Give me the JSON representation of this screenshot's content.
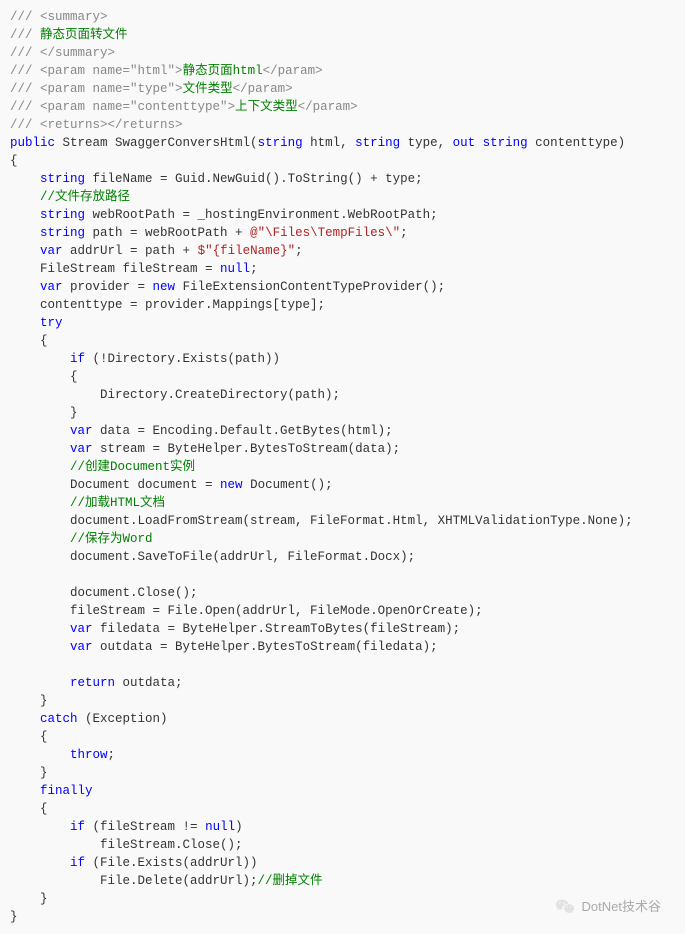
{
  "lines": [
    {
      "indent": 0,
      "spans": [
        {
          "t": "/// <summary>",
          "c": "comment"
        }
      ]
    },
    {
      "indent": 0,
      "spans": [
        {
          "t": "/// ",
          "c": "comment"
        },
        {
          "t": "静态页面转文件",
          "c": "green"
        }
      ]
    },
    {
      "indent": 0,
      "spans": [
        {
          "t": "/// </summary>",
          "c": "comment"
        }
      ]
    },
    {
      "indent": 0,
      "spans": [
        {
          "t": "/// <param name=",
          "c": "comment"
        },
        {
          "t": "\"html\"",
          "c": "comment"
        },
        {
          "t": ">",
          "c": "comment"
        },
        {
          "t": "静态页面html",
          "c": "green"
        },
        {
          "t": "</param>",
          "c": "comment"
        }
      ]
    },
    {
      "indent": 0,
      "spans": [
        {
          "t": "/// <param name=",
          "c": "comment"
        },
        {
          "t": "\"type\"",
          "c": "comment"
        },
        {
          "t": ">",
          "c": "comment"
        },
        {
          "t": "文件类型",
          "c": "green"
        },
        {
          "t": "</param>",
          "c": "comment"
        }
      ]
    },
    {
      "indent": 0,
      "spans": [
        {
          "t": "/// <param name=",
          "c": "comment"
        },
        {
          "t": "\"contenttype\"",
          "c": "comment"
        },
        {
          "t": ">",
          "c": "comment"
        },
        {
          "t": "上下文类型",
          "c": "green"
        },
        {
          "t": "</param>",
          "c": "comment"
        }
      ]
    },
    {
      "indent": 0,
      "spans": [
        {
          "t": "/// <returns></returns>",
          "c": "comment"
        }
      ]
    },
    {
      "indent": 0,
      "spans": [
        {
          "t": "public",
          "c": "keyword"
        },
        {
          "t": " Stream SwaggerConversHtml(",
          "c": "plain"
        },
        {
          "t": "string",
          "c": "keyword"
        },
        {
          "t": " html, ",
          "c": "plain"
        },
        {
          "t": "string",
          "c": "keyword"
        },
        {
          "t": " type, ",
          "c": "plain"
        },
        {
          "t": "out",
          "c": "keyword"
        },
        {
          "t": " ",
          "c": "plain"
        },
        {
          "t": "string",
          "c": "keyword"
        },
        {
          "t": " contenttype)",
          "c": "plain"
        }
      ]
    },
    {
      "indent": 0,
      "spans": [
        {
          "t": "{",
          "c": "plain"
        }
      ]
    },
    {
      "indent": 1,
      "spans": [
        {
          "t": "string",
          "c": "keyword"
        },
        {
          "t": " fileName = Guid.NewGuid().ToString() + type;",
          "c": "plain"
        }
      ]
    },
    {
      "indent": 1,
      "spans": [
        {
          "t": "//文件存放路径",
          "c": "green"
        }
      ]
    },
    {
      "indent": 1,
      "spans": [
        {
          "t": "string",
          "c": "keyword"
        },
        {
          "t": " webRootPath = _hostingEnvironment.WebRootPath;",
          "c": "plain"
        }
      ]
    },
    {
      "indent": 1,
      "spans": [
        {
          "t": "string",
          "c": "keyword"
        },
        {
          "t": " path = webRootPath + ",
          "c": "plain"
        },
        {
          "t": "@\"\\Files\\TempFiles\\\"",
          "c": "string"
        },
        {
          "t": ";",
          "c": "plain"
        }
      ]
    },
    {
      "indent": 1,
      "spans": [
        {
          "t": "var",
          "c": "keyword"
        },
        {
          "t": " addrUrl = path + ",
          "c": "plain"
        },
        {
          "t": "$\"{fileName}\"",
          "c": "string"
        },
        {
          "t": ";",
          "c": "plain"
        }
      ]
    },
    {
      "indent": 1,
      "spans": [
        {
          "t": "FileStream fileStream = ",
          "c": "plain"
        },
        {
          "t": "null",
          "c": "keyword"
        },
        {
          "t": ";",
          "c": "plain"
        }
      ]
    },
    {
      "indent": 1,
      "spans": [
        {
          "t": "var",
          "c": "keyword"
        },
        {
          "t": " provider = ",
          "c": "plain"
        },
        {
          "t": "new",
          "c": "keyword"
        },
        {
          "t": " FileExtensionContentTypeProvider();",
          "c": "plain"
        }
      ]
    },
    {
      "indent": 1,
      "spans": [
        {
          "t": "contenttype = provider.Mappings[type];",
          "c": "plain"
        }
      ]
    },
    {
      "indent": 1,
      "spans": [
        {
          "t": "try",
          "c": "keyword"
        }
      ]
    },
    {
      "indent": 1,
      "spans": [
        {
          "t": "{",
          "c": "plain"
        }
      ]
    },
    {
      "indent": 2,
      "spans": [
        {
          "t": "if",
          "c": "keyword"
        },
        {
          "t": " (!Directory.Exists(path))",
          "c": "plain"
        }
      ]
    },
    {
      "indent": 2,
      "spans": [
        {
          "t": "{",
          "c": "plain"
        }
      ]
    },
    {
      "indent": 3,
      "spans": [
        {
          "t": "Directory.CreateDirectory(path);",
          "c": "plain"
        }
      ]
    },
    {
      "indent": 2,
      "spans": [
        {
          "t": "}",
          "c": "plain"
        }
      ]
    },
    {
      "indent": 2,
      "spans": [
        {
          "t": "var",
          "c": "keyword"
        },
        {
          "t": " data = Encoding.Default.GetBytes(html);",
          "c": "plain"
        }
      ]
    },
    {
      "indent": 2,
      "spans": [
        {
          "t": "var",
          "c": "keyword"
        },
        {
          "t": " stream = ByteHelper.BytesToStream(data);",
          "c": "plain"
        }
      ]
    },
    {
      "indent": 2,
      "spans": [
        {
          "t": "//创建Document实例",
          "c": "green"
        }
      ]
    },
    {
      "indent": 2,
      "spans": [
        {
          "t": "Document document = ",
          "c": "plain"
        },
        {
          "t": "new",
          "c": "keyword"
        },
        {
          "t": " Document();",
          "c": "plain"
        }
      ]
    },
    {
      "indent": 2,
      "spans": [
        {
          "t": "//加载HTML文档",
          "c": "green"
        }
      ]
    },
    {
      "indent": 2,
      "spans": [
        {
          "t": "document.LoadFromStream(stream, FileFormat.Html, XHTMLValidationType.None);",
          "c": "plain"
        }
      ]
    },
    {
      "indent": 2,
      "spans": [
        {
          "t": "//保存为Word",
          "c": "green"
        }
      ]
    },
    {
      "indent": 2,
      "spans": [
        {
          "t": "document.SaveToFile(addrUrl, FileFormat.Docx);",
          "c": "plain"
        }
      ]
    },
    {
      "indent": 0,
      "spans": [
        {
          "t": " ",
          "c": "plain"
        }
      ]
    },
    {
      "indent": 2,
      "spans": [
        {
          "t": "document.Close();",
          "c": "plain"
        }
      ]
    },
    {
      "indent": 2,
      "spans": [
        {
          "t": "fileStream = File.Open(addrUrl, FileMode.OpenOrCreate);",
          "c": "plain"
        }
      ]
    },
    {
      "indent": 2,
      "spans": [
        {
          "t": "var",
          "c": "keyword"
        },
        {
          "t": " filedata = ByteHelper.StreamToBytes(fileStream);",
          "c": "plain"
        }
      ]
    },
    {
      "indent": 2,
      "spans": [
        {
          "t": "var",
          "c": "keyword"
        },
        {
          "t": " outdata = ByteHelper.BytesToStream(filedata);",
          "c": "plain"
        }
      ]
    },
    {
      "indent": 0,
      "spans": [
        {
          "t": " ",
          "c": "plain"
        }
      ]
    },
    {
      "indent": 2,
      "spans": [
        {
          "t": "return",
          "c": "keyword"
        },
        {
          "t": " outdata;",
          "c": "plain"
        }
      ]
    },
    {
      "indent": 1,
      "spans": [
        {
          "t": "}",
          "c": "plain"
        }
      ]
    },
    {
      "indent": 1,
      "spans": [
        {
          "t": "catch",
          "c": "keyword"
        },
        {
          "t": " (Exception)",
          "c": "plain"
        }
      ]
    },
    {
      "indent": 1,
      "spans": [
        {
          "t": "{",
          "c": "plain"
        }
      ]
    },
    {
      "indent": 2,
      "spans": [
        {
          "t": "throw",
          "c": "keyword"
        },
        {
          "t": ";",
          "c": "plain"
        }
      ]
    },
    {
      "indent": 1,
      "spans": [
        {
          "t": "}",
          "c": "plain"
        }
      ]
    },
    {
      "indent": 1,
      "spans": [
        {
          "t": "finally",
          "c": "keyword"
        }
      ]
    },
    {
      "indent": 1,
      "spans": [
        {
          "t": "{",
          "c": "plain"
        }
      ]
    },
    {
      "indent": 2,
      "spans": [
        {
          "t": "if",
          "c": "keyword"
        },
        {
          "t": " (fileStream != ",
          "c": "plain"
        },
        {
          "t": "null",
          "c": "keyword"
        },
        {
          "t": ")",
          "c": "plain"
        }
      ]
    },
    {
      "indent": 3,
      "spans": [
        {
          "t": "fileStream.Close();",
          "c": "plain"
        }
      ]
    },
    {
      "indent": 2,
      "spans": [
        {
          "t": "if",
          "c": "keyword"
        },
        {
          "t": " (File.Exists(addrUrl))",
          "c": "plain"
        }
      ]
    },
    {
      "indent": 3,
      "spans": [
        {
          "t": "File.Delete(addrUrl);",
          "c": "plain"
        },
        {
          "t": "//删掉文件",
          "c": "green"
        }
      ]
    },
    {
      "indent": 1,
      "spans": [
        {
          "t": "}",
          "c": "plain"
        }
      ]
    },
    {
      "indent": 0,
      "spans": [
        {
          "t": "}",
          "c": "plain"
        }
      ]
    }
  ],
  "watermark": {
    "text": "DotNet技术谷"
  }
}
